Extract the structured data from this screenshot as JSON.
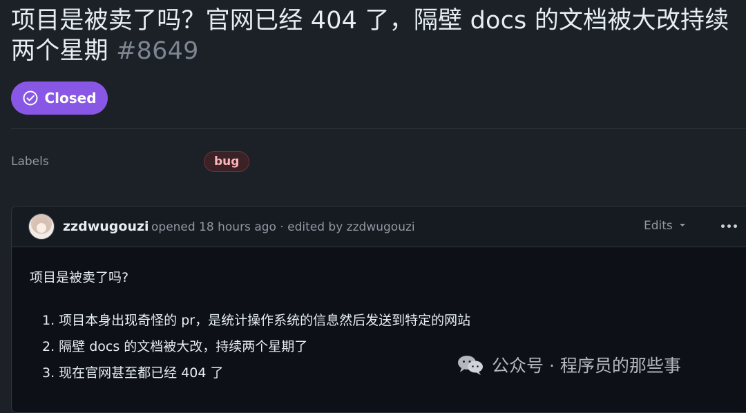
{
  "issue": {
    "title": "项目是被卖了吗？官网已经 404 了，隔壁 docs 的文档被大改持续两个星期",
    "number": "#8649",
    "state": "Closed"
  },
  "labels": {
    "title": "Labels",
    "items": [
      "bug"
    ]
  },
  "comment": {
    "author": "zzdwugouzi",
    "meta": "opened 18 hours ago · edited by zzdwugouzi",
    "edits_label": "Edits",
    "body": "项目是被卖了吗?",
    "list": [
      "1. 项目本身出现奇怪的 pr，是统计操作系统的信息然后发送到特定的网站",
      "2. 隔壁 docs 的文档被大改，持续两个星期了",
      "3. 现在官网甚至都已经 404 了"
    ]
  },
  "watermark": {
    "text": "公众号 · 程序员的那些事"
  },
  "colors": {
    "background": "#1c2128",
    "closed_badge": "#8957e5",
    "label_bug": "#ffb4ba"
  }
}
